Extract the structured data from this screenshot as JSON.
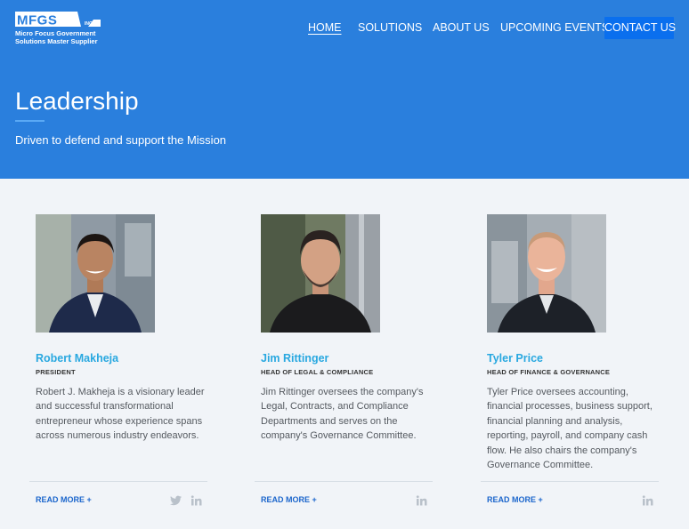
{
  "brand": {
    "logo_text": "MFGS INC.",
    "tagline_line1": "Micro Focus Government",
    "tagline_line2": "Solutions Master Supplier"
  },
  "nav": {
    "items": [
      {
        "label": "HOME",
        "active": true
      },
      {
        "label": "SOLUTIONS"
      },
      {
        "label": "ABOUT US"
      },
      {
        "label": "UPCOMING EVENTS"
      },
      {
        "label": "CONTACT US",
        "highlighted": true
      }
    ]
  },
  "hero": {
    "title": "Leadership",
    "subtitle": "Driven to defend and support the Mission"
  },
  "people": [
    {
      "name": "Robert Makheja",
      "role": "PRESIDENT",
      "bio": "Robert J. Makheja is a visionary leader and successful transformational entrepreneur whose experience spans across numerous industry endeavors.",
      "read_more": "READ MORE +",
      "social": [
        "twitter-icon",
        "linkedin-icon"
      ]
    },
    {
      "name": "Jim Rittinger",
      "role": "HEAD OF LEGAL & COMPLIANCE",
      "bio": "Jim Rittinger oversees the company's Legal, Contracts, and Compliance Departments and serves on the company's Governance Committee.",
      "read_more": "READ MORE +",
      "social": [
        "linkedin-icon"
      ]
    },
    {
      "name": "Tyler Price",
      "role": "HEAD OF FINANCE & GOVERNANCE",
      "bio": "Tyler Price oversees accounting, financial processes, business support, financial planning and analysis, reporting, payroll, and company cash flow. He also chairs the company's Governance Committee.",
      "read_more": "READ MORE +",
      "social": [
        "linkedin-icon"
      ]
    }
  ],
  "colors": {
    "hero_bg": "#2a7fdd",
    "contact_button": "#0a6fee",
    "name_accent": "#29a8e0",
    "link": "#1c66cc",
    "page_bg": "#f1f4f8"
  }
}
